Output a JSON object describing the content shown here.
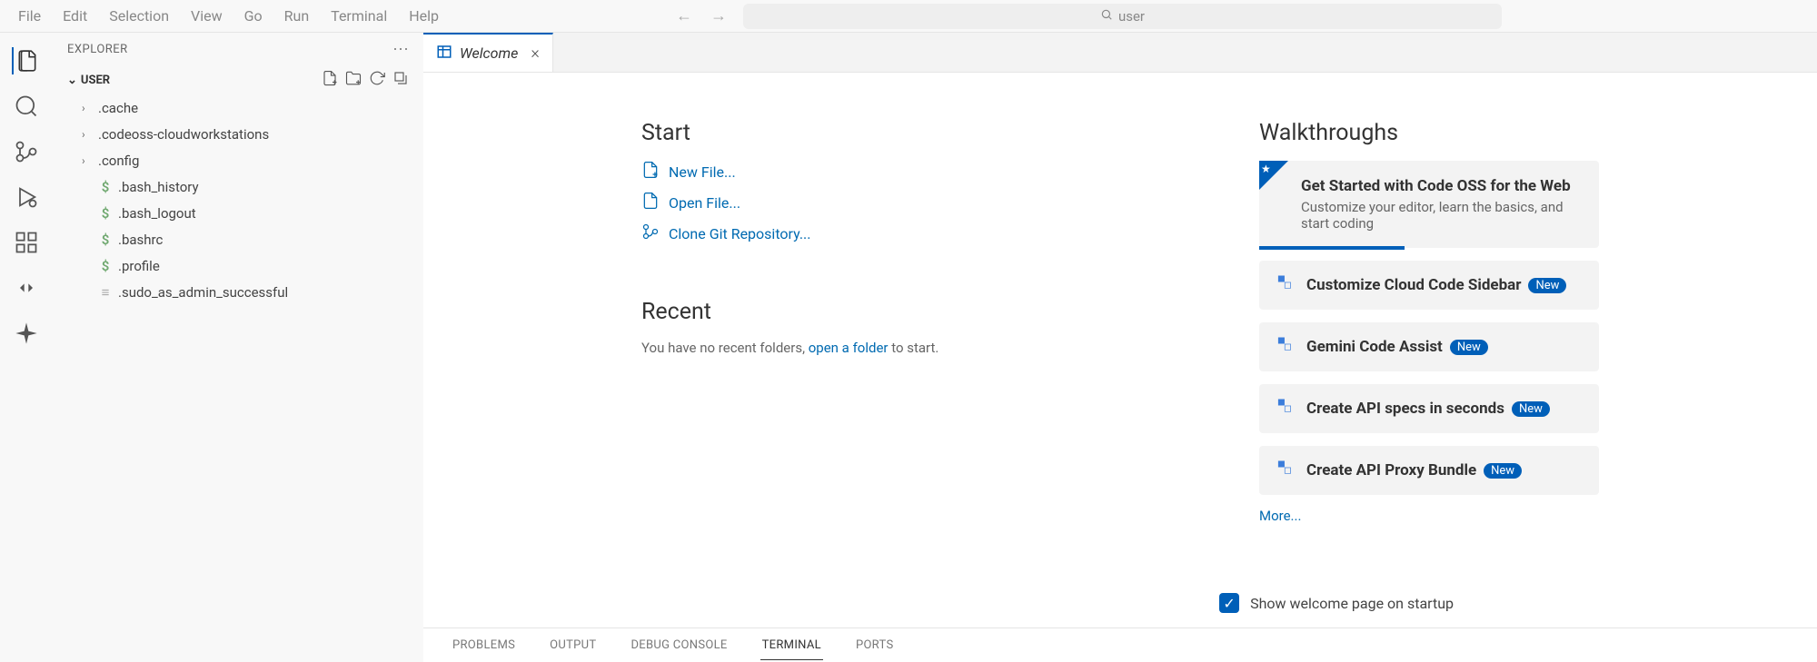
{
  "menu": [
    "File",
    "Edit",
    "Selection",
    "View",
    "Go",
    "Run",
    "Terminal",
    "Help"
  ],
  "search": {
    "value": "user"
  },
  "sidebar": {
    "title": "EXPLORER",
    "root": "USER",
    "items": [
      {
        "type": "folder",
        "name": ".cache"
      },
      {
        "type": "folder",
        "name": ".codeoss-cloudworkstations"
      },
      {
        "type": "folder",
        "name": ".config"
      },
      {
        "type": "file",
        "icon": "dollar",
        "name": ".bash_history"
      },
      {
        "type": "file",
        "icon": "dollar",
        "name": ".bash_logout"
      },
      {
        "type": "file",
        "icon": "dollar",
        "name": ".bashrc"
      },
      {
        "type": "file",
        "icon": "dollar",
        "name": ".profile"
      },
      {
        "type": "file",
        "icon": "lines",
        "name": ".sudo_as_admin_successful"
      }
    ]
  },
  "tab": {
    "label": "Welcome"
  },
  "start": {
    "heading": "Start",
    "items": [
      "New File...",
      "Open File...",
      "Clone Git Repository..."
    ]
  },
  "recent": {
    "heading": "Recent",
    "text_pre": "You have no recent folders, ",
    "link": "open a folder",
    "text_post": " to start."
  },
  "walkthroughs": {
    "heading": "Walkthroughs",
    "featured": {
      "title": "Get Started with Code OSS for the Web",
      "desc": "Customize your editor, learn the basics, and start coding"
    },
    "items": [
      {
        "title": "Customize Cloud Code Sidebar",
        "new": true
      },
      {
        "title": "Gemini Code Assist",
        "new": true
      },
      {
        "title": "Create API specs in seconds",
        "new": true
      },
      {
        "title": "Create API Proxy Bundle",
        "new": true
      }
    ],
    "more": "More...",
    "new_label": "New"
  },
  "startup_checkbox": "Show welcome page on startup",
  "panel_tabs": [
    "PROBLEMS",
    "OUTPUT",
    "DEBUG CONSOLE",
    "TERMINAL",
    "PORTS"
  ],
  "panel_active": 3
}
